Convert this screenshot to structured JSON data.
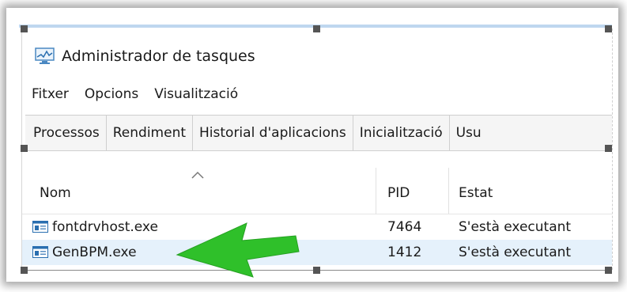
{
  "window": {
    "title": "Administrador de tasques",
    "app_icon": "task-manager-icon"
  },
  "menu": [
    "Fitxer",
    "Opcions",
    "Visualització"
  ],
  "tabs": [
    "Processos",
    "Rendiment",
    "Historial d'aplicacions",
    "Inicialització",
    "Usu"
  ],
  "table": {
    "sort_indicator": "chevron-up-icon",
    "columns": [
      "Nom",
      "PID",
      "Estat"
    ],
    "rows": [
      {
        "name": "fontdrvhost.exe",
        "pid": "7464",
        "status": "S'està executant",
        "selected": false
      },
      {
        "name": "GenBPM.exe",
        "pid": "1412",
        "status": "S'està executant",
        "selected": true
      }
    ]
  },
  "annotation": {
    "icon": "green-pointer-arrow-icon",
    "color": "#2fc02a"
  },
  "colors": {
    "selected_row": "#e5f1fb",
    "tab_strip": "#f5f5f5",
    "accent": "#2fc02a"
  }
}
